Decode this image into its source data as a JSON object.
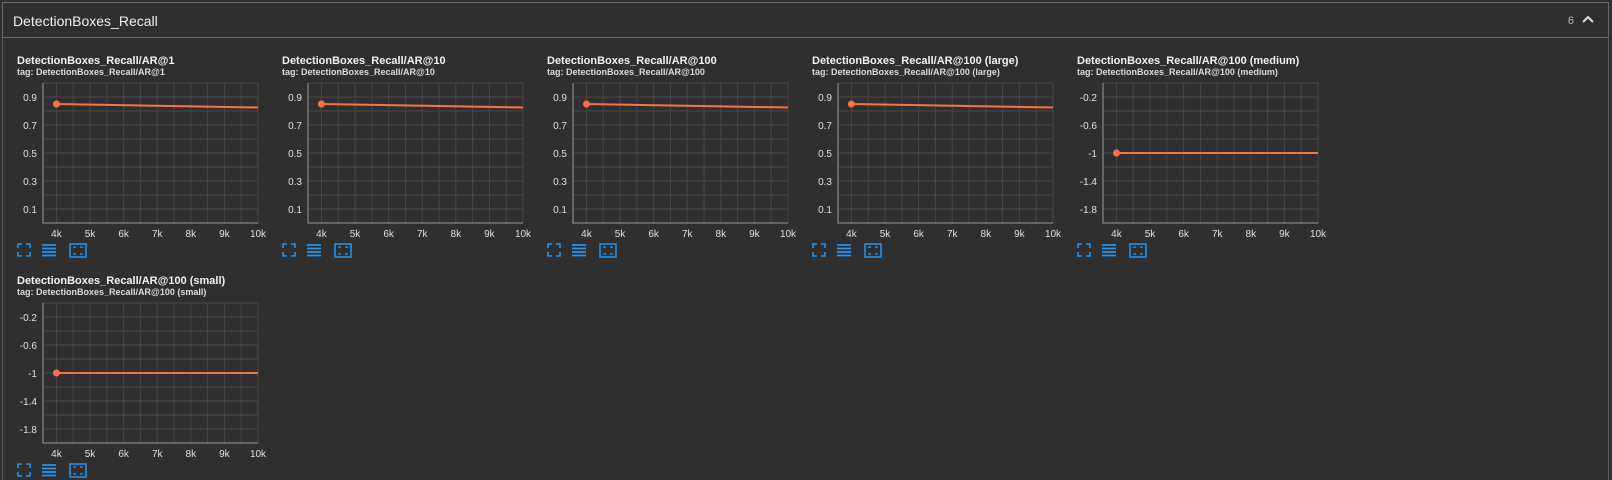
{
  "header": {
    "title": "DetectionBoxes_Recall",
    "count": "6"
  },
  "cards": [
    {
      "title": "DetectionBoxes_Recall/AR@1",
      "tag": "tag: DetectionBoxes_Recall/AR@1",
      "yticks": [
        "0.9",
        "0.7",
        "0.5",
        "0.3",
        "0.1"
      ],
      "xticks": [
        "4k",
        "5k",
        "6k",
        "7k",
        "8k",
        "9k",
        "10k"
      ]
    },
    {
      "title": "DetectionBoxes_Recall/AR@10",
      "tag": "tag: DetectionBoxes_Recall/AR@10",
      "yticks": [
        "0.9",
        "0.7",
        "0.5",
        "0.3",
        "0.1"
      ],
      "xticks": [
        "4k",
        "5k",
        "6k",
        "7k",
        "8k",
        "9k",
        "10k"
      ]
    },
    {
      "title": "DetectionBoxes_Recall/AR@100",
      "tag": "tag: DetectionBoxes_Recall/AR@100",
      "yticks": [
        "0.9",
        "0.7",
        "0.5",
        "0.3",
        "0.1"
      ],
      "xticks": [
        "4k",
        "5k",
        "6k",
        "7k",
        "8k",
        "9k",
        "10k"
      ]
    },
    {
      "title": "DetectionBoxes_Recall/AR@100 (large)",
      "tag": "tag: DetectionBoxes_Recall/AR@100 (large)",
      "yticks": [
        "0.9",
        "0.7",
        "0.5",
        "0.3",
        "0.1"
      ],
      "xticks": [
        "4k",
        "5k",
        "6k",
        "7k",
        "8k",
        "9k",
        "10k"
      ]
    },
    {
      "title": "DetectionBoxes_Recall/AR@100 (medium)",
      "tag": "tag: DetectionBoxes_Recall/AR@100 (medium)",
      "yticks": [
        "-0.2",
        "-0.6",
        "-1",
        "-1.4",
        "-1.8"
      ],
      "xticks": [
        "4k",
        "5k",
        "6k",
        "7k",
        "8k",
        "9k",
        "10k"
      ]
    },
    {
      "title": "DetectionBoxes_Recall/AR@100 (small)",
      "tag": "tag: DetectionBoxes_Recall/AR@100 (small)",
      "yticks": [
        "-0.2",
        "-0.6",
        "-1",
        "-1.4",
        "-1.8"
      ],
      "xticks": [
        "4k",
        "5k",
        "6k",
        "7k",
        "8k",
        "9k",
        "10k"
      ]
    }
  ],
  "colors": {
    "line": "#ff7043",
    "grid": "#474747",
    "axis": "#9a9a9a",
    "tick_text": "#e0e0e0",
    "tool_icon": "#2196f3"
  },
  "chart_data": [
    {
      "type": "line",
      "x": [
        4000,
        10000
      ],
      "series": [
        {
          "values": [
            0.85,
            0.825
          ]
        }
      ],
      "xlim": [
        3600,
        10000
      ],
      "ylim": [
        0,
        1.0
      ],
      "grid": true
    },
    {
      "type": "line",
      "x": [
        4000,
        10000
      ],
      "series": [
        {
          "values": [
            0.85,
            0.825
          ]
        }
      ],
      "xlim": [
        3600,
        10000
      ],
      "ylim": [
        0,
        1.0
      ],
      "grid": true
    },
    {
      "type": "line",
      "x": [
        4000,
        10000
      ],
      "series": [
        {
          "values": [
            0.85,
            0.825
          ]
        }
      ],
      "xlim": [
        3600,
        10000
      ],
      "ylim": [
        0,
        1.0
      ],
      "grid": true
    },
    {
      "type": "line",
      "x": [
        4000,
        10000
      ],
      "series": [
        {
          "values": [
            0.85,
            0.825
          ]
        }
      ],
      "xlim": [
        3600,
        10000
      ],
      "ylim": [
        0,
        1.0
      ],
      "grid": true
    },
    {
      "type": "line",
      "x": [
        4000,
        10000
      ],
      "series": [
        {
          "values": [
            -1,
            -1
          ]
        }
      ],
      "xlim": [
        3600,
        10000
      ],
      "ylim": [
        -2.0,
        0
      ],
      "grid": true
    },
    {
      "type": "line",
      "x": [
        4000,
        10000
      ],
      "series": [
        {
          "values": [
            -1,
            -1
          ]
        }
      ],
      "xlim": [
        3600,
        10000
      ],
      "ylim": [
        -2.0,
        0
      ],
      "grid": true
    }
  ]
}
